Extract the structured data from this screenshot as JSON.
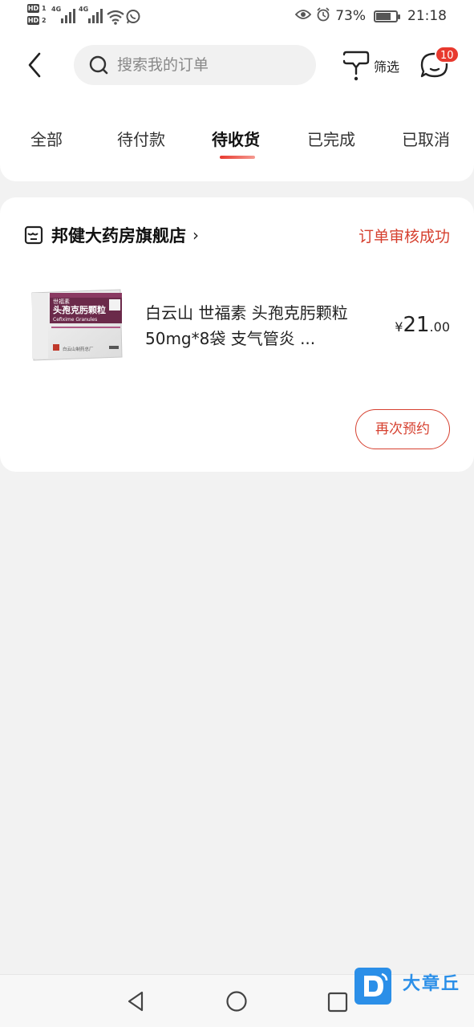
{
  "status_bar": {
    "hd1": "HD",
    "hd1_sub": "1",
    "hd2": "HD",
    "hd2_sub": "2",
    "net1": "4G",
    "net2": "4G",
    "battery_percent": "73%",
    "battery_level": 0.73,
    "time": "21:18"
  },
  "header": {
    "search_placeholder": "搜索我的订单",
    "filter_label": "筛选",
    "message_badge": "10"
  },
  "tabs": [
    {
      "label": "全部",
      "active": false
    },
    {
      "label": "待付款",
      "active": false
    },
    {
      "label": "待收货",
      "active": true
    },
    {
      "label": "已完成",
      "active": false
    },
    {
      "label": "已取消",
      "active": false
    }
  ],
  "order": {
    "store_name": "邦健大药房旗舰店",
    "status": "订单审核成功",
    "product_title": "白云山 世福素 头孢克肟颗粒 50mg*8袋 支气管炎 ...",
    "price_currency": "¥",
    "price_int": "21",
    "price_dec": ".00",
    "rebook_label": "再次预约",
    "package": {
      "brand": "世福素",
      "name_cn": "头孢克肟颗粒",
      "name_en": "Cefixime Granules",
      "maker": "白云山制药总厂"
    }
  },
  "watermark": {
    "text": "大章丘"
  },
  "colors": {
    "accent": "#d6402f",
    "badge": "#e8392e",
    "background": "#f2f2f2",
    "card": "#ffffff",
    "package_purple": "#6b2a4a",
    "watermark_blue": "#2b8fe8"
  }
}
